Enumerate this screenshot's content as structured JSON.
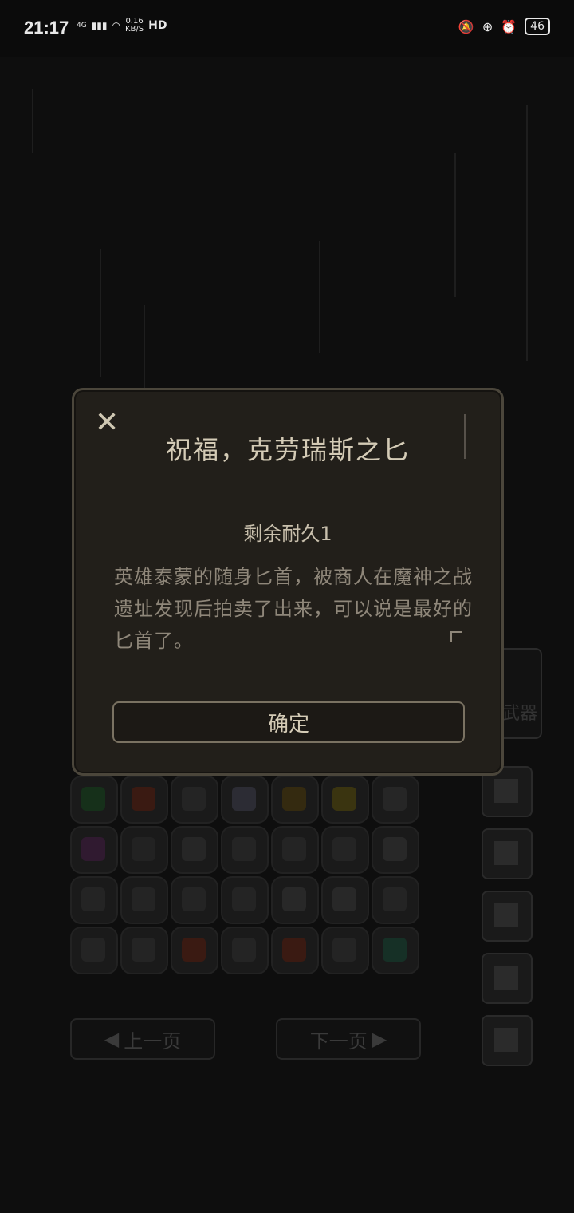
{
  "status_bar": {
    "time": "21:17",
    "network": "4G",
    "speed": "0.16",
    "speed_unit": "KB/S",
    "hd": "HD",
    "battery": "46"
  },
  "dialog": {
    "title": "祝福，克劳瑞斯之匕",
    "durability": "剩余耐久1",
    "description": "英雄泰蒙的随身匕首，被商人在魔神之战遗址发现后拍卖了出来，可以说是最好的匕首了。",
    "confirm_label": "确定",
    "close_icon": "close-icon"
  },
  "background": {
    "weapon_label": "武器",
    "prev_page": "上一页",
    "next_page": "下一页"
  },
  "colors": {
    "dialog_bg": "#221f1a",
    "dialog_border": "#4b463b",
    "text_primary": "#d4cbb6",
    "text_secondary": "#8f877a"
  }
}
